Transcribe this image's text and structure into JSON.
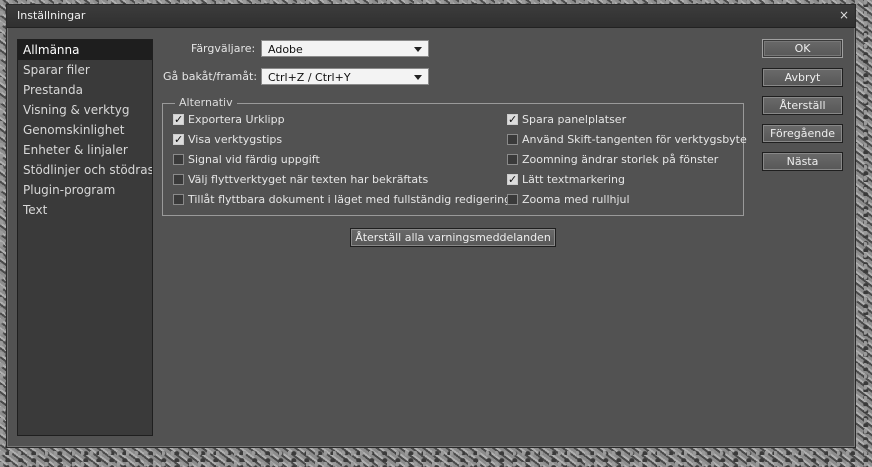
{
  "window": {
    "title": "Inställningar",
    "close_glyph": "×"
  },
  "sidebar": {
    "items": [
      {
        "label": "Allmänna",
        "active": true
      },
      {
        "label": "Sparar filer"
      },
      {
        "label": "Prestanda"
      },
      {
        "label": "Visning & verktyg"
      },
      {
        "label": "Genomskinlighet"
      },
      {
        "label": "Enheter & linjaler"
      },
      {
        "label": "Stödlinjer och stödraster"
      },
      {
        "label": "Plugin-program"
      },
      {
        "label": "Text"
      }
    ]
  },
  "general": {
    "color_picker_label": "Färgväljare:",
    "color_picker_value": "Adobe",
    "step_label": "Gå bakåt/framåt:",
    "step_value": "Ctrl+Z / Ctrl+Y"
  },
  "options": {
    "legend": "Alternativ",
    "left": [
      {
        "label": "Exportera Urklipp",
        "checked": true
      },
      {
        "label": "Visa verktygstips",
        "checked": true
      },
      {
        "label": "Signal vid färdig uppgift",
        "checked": false
      },
      {
        "label": "Välj flyttverktyget när texten har bekräftats",
        "checked": false
      },
      {
        "label": "Tillåt flyttbara dokument i läget med fullständig redigering",
        "checked": false
      }
    ],
    "right": [
      {
        "label": "Spara panelplatser",
        "checked": true
      },
      {
        "label": "Använd Skift-tangenten för verktygsbyte",
        "checked": false
      },
      {
        "label": "Zoomning ändrar storlek på fönster",
        "checked": false
      },
      {
        "label": "Lätt textmarkering",
        "checked": true
      },
      {
        "label": "Zooma med rullhjul",
        "checked": false
      }
    ]
  },
  "reset_warnings_label": "Återställ alla varningsmeddelanden",
  "buttons": {
    "ok": "OK",
    "cancel": "Avbryt",
    "reset": "Återställ",
    "previous": "Föregående",
    "next": "Nästa"
  },
  "colors": {
    "dialog_bg": "#525252",
    "sidebar_bg": "#3a3a3a",
    "selected_bg": "#1e1e1e",
    "text": "#e6e6e6"
  }
}
